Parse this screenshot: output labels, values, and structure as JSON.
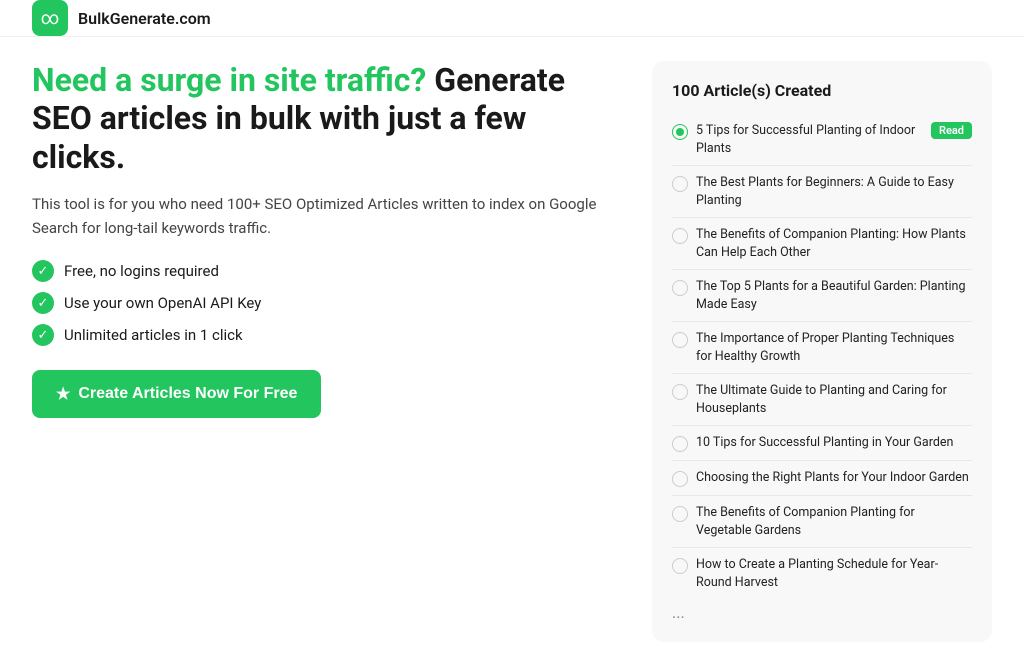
{
  "header": {
    "logo_text": "BulkGenerate.com",
    "logo_icon": "∞"
  },
  "left": {
    "headline_green": "Need a surge in site traffic?",
    "headline_black": " Generate SEO articles in bulk with just a few clicks.",
    "description": "This tool is for you who need 100+ SEO Optimized Articles written to index on Google Search for long-tail keywords traffic.",
    "features": [
      "Free, no logins required",
      "Use your own OpenAI API Key",
      "Unlimited articles in 1 click"
    ],
    "cta_label": "Create Articles Now For Free",
    "star_icon": "★"
  },
  "right": {
    "title": "100 Article(s) Created",
    "articles": [
      {
        "title": "5 Tips for Successful Planting of Indoor Plants",
        "completed": true,
        "badge": "Read"
      },
      {
        "title": "The Best Plants for Beginners: A Guide to Easy Planting",
        "completed": false,
        "badge": ""
      },
      {
        "title": "The Benefits of Companion Planting: How Plants Can Help Each Other",
        "completed": false,
        "badge": ""
      },
      {
        "title": "The Top 5 Plants for a Beautiful Garden: Planting Made Easy",
        "completed": false,
        "badge": ""
      },
      {
        "title": "The Importance of Proper Planting Techniques for Healthy Growth",
        "completed": false,
        "badge": ""
      },
      {
        "title": "The Ultimate Guide to Planting and Caring for Houseplants",
        "completed": false,
        "badge": ""
      },
      {
        "title": "10 Tips for Successful Planting in Your Garden",
        "completed": false,
        "badge": ""
      },
      {
        "title": "Choosing the Right Plants for Your Indoor Garden",
        "completed": false,
        "badge": ""
      },
      {
        "title": "The Benefits of Companion Planting for Vegetable Gardens",
        "completed": false,
        "badge": ""
      },
      {
        "title": "How to Create a Planting Schedule for Year-Round Harvest",
        "completed": false,
        "badge": ""
      }
    ],
    "ellipsis": "..."
  }
}
